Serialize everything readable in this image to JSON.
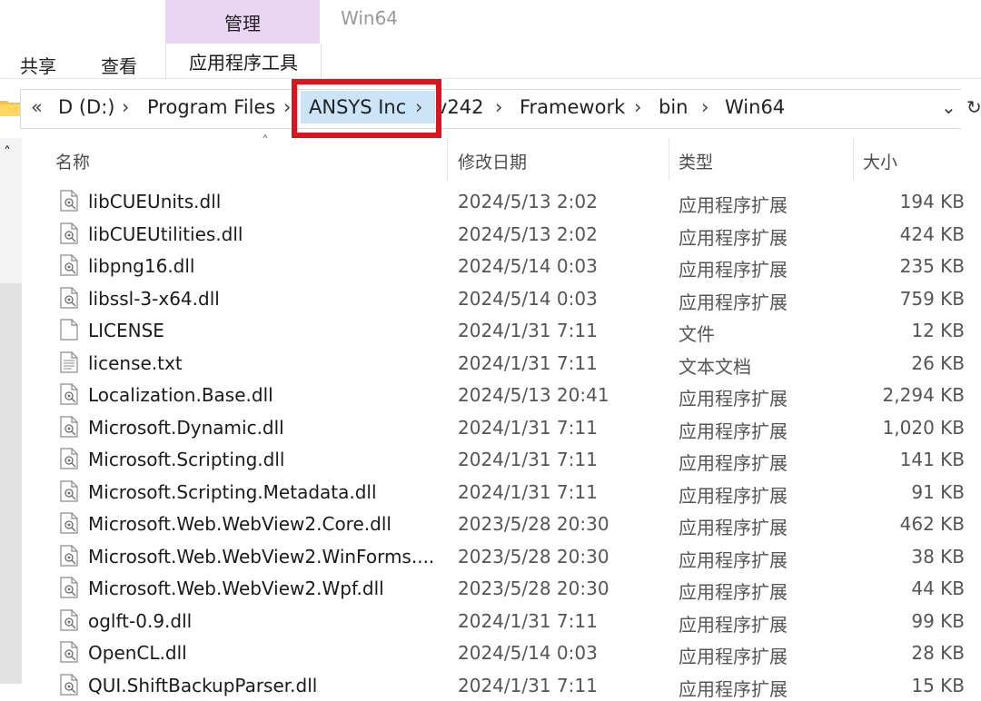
{
  "ribbon": {
    "context_group": "管理",
    "window_title": "Win64",
    "tabs": [
      "共享",
      "查看",
      "应用程序工具"
    ]
  },
  "address_bar": {
    "overflow": "«",
    "crumbs": [
      "D (D:)",
      "Program Files",
      "ANSYS Inc",
      "v242",
      "Framework",
      "bin",
      "Win64"
    ],
    "highlighted_crumb": "ANSYS Inc",
    "highlight_color": "#e0121c"
  },
  "columns": {
    "name": "名称",
    "date": "修改日期",
    "type": "类型",
    "size": "大小"
  },
  "files": [
    {
      "name": "libCUEUnits.dll",
      "date": "2024/5/13 2:02",
      "type": "应用程序扩展",
      "size": "194 KB",
      "icon": "dll-icon"
    },
    {
      "name": "libCUEUtilities.dll",
      "date": "2024/5/13 2:02",
      "type": "应用程序扩展",
      "size": "424 KB",
      "icon": "dll-icon"
    },
    {
      "name": "libpng16.dll",
      "date": "2024/5/14 0:03",
      "type": "应用程序扩展",
      "size": "235 KB",
      "icon": "dll-icon"
    },
    {
      "name": "libssl-3-x64.dll",
      "date": "2024/5/14 0:03",
      "type": "应用程序扩展",
      "size": "759 KB",
      "icon": "dll-icon"
    },
    {
      "name": "LICENSE",
      "date": "2024/1/31 7:11",
      "type": "文件",
      "size": "12 KB",
      "icon": "file-icon"
    },
    {
      "name": "license.txt",
      "date": "2024/1/31 7:11",
      "type": "文本文档",
      "size": "26 KB",
      "icon": "text-file-icon"
    },
    {
      "name": "Localization.Base.dll",
      "date": "2024/5/13 20:41",
      "type": "应用程序扩展",
      "size": "2,294 KB",
      "icon": "dll-icon"
    },
    {
      "name": "Microsoft.Dynamic.dll",
      "date": "2024/1/31 7:11",
      "type": "应用程序扩展",
      "size": "1,020 KB",
      "icon": "dll-icon"
    },
    {
      "name": "Microsoft.Scripting.dll",
      "date": "2024/1/31 7:11",
      "type": "应用程序扩展",
      "size": "141 KB",
      "icon": "dll-icon"
    },
    {
      "name": "Microsoft.Scripting.Metadata.dll",
      "date": "2024/1/31 7:11",
      "type": "应用程序扩展",
      "size": "91 KB",
      "icon": "dll-icon"
    },
    {
      "name": "Microsoft.Web.WebView2.Core.dll",
      "date": "2023/5/28 20:30",
      "type": "应用程序扩展",
      "size": "462 KB",
      "icon": "dll-icon"
    },
    {
      "name": "Microsoft.Web.WebView2.WinForms....",
      "date": "2023/5/28 20:30",
      "type": "应用程序扩展",
      "size": "38 KB",
      "icon": "dll-icon"
    },
    {
      "name": "Microsoft.Web.WebView2.Wpf.dll",
      "date": "2023/5/28 20:30",
      "type": "应用程序扩展",
      "size": "44 KB",
      "icon": "dll-icon"
    },
    {
      "name": "oglft-0.9.dll",
      "date": "2024/1/31 7:11",
      "type": "应用程序扩展",
      "size": "99 KB",
      "icon": "dll-icon"
    },
    {
      "name": "OpenCL.dll",
      "date": "2024/5/14 0:03",
      "type": "应用程序扩展",
      "size": "28 KB",
      "icon": "dll-icon"
    },
    {
      "name": "QUI.ShiftBackupParser.dll",
      "date": "2024/1/31 7:11",
      "type": "应用程序扩展",
      "size": "15 KB",
      "icon": "dll-icon"
    }
  ]
}
